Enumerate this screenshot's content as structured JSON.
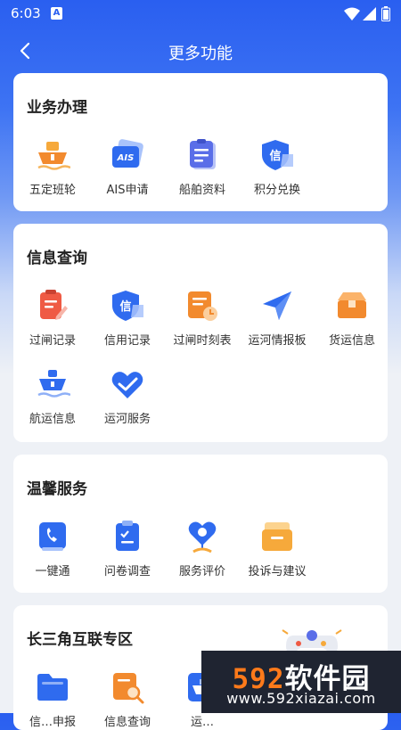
{
  "status_bar": {
    "time": "6:03",
    "notification_badge": "A"
  },
  "nav": {
    "title": "更多功能",
    "back_icon": "chevron-left-icon"
  },
  "sections": [
    {
      "title": "业务办理",
      "items": [
        {
          "label": "五定班轮",
          "icon": "ship-icon"
        },
        {
          "label": "AIS申请",
          "icon": "ais-icon",
          "icon_text": "AIS"
        },
        {
          "label": "船舶资料",
          "icon": "clipboard-icon"
        },
        {
          "label": "积分兑换",
          "icon": "credit-shield-icon",
          "icon_text": "信"
        }
      ]
    },
    {
      "title": "信息查询",
      "items": [
        {
          "label": "过闸记录",
          "icon": "record-edit-icon"
        },
        {
          "label": "信用记录",
          "icon": "credit-shield-icon",
          "icon_text": "信"
        },
        {
          "label": "过闸时刻表",
          "icon": "schedule-clock-icon"
        },
        {
          "label": "运河情报板",
          "icon": "paper-plane-icon"
        },
        {
          "label": "货运信息",
          "icon": "cargo-box-icon"
        },
        {
          "label": "航运信息",
          "icon": "ship-wave-icon"
        },
        {
          "label": "运河服务",
          "icon": "heart-hands-icon"
        }
      ]
    },
    {
      "title": "温馨服务",
      "items": [
        {
          "label": "一键通",
          "icon": "phone-icon"
        },
        {
          "label": "问卷调查",
          "icon": "survey-icon"
        },
        {
          "label": "服务评价",
          "icon": "heart-pin-icon"
        },
        {
          "label": "投诉与建议",
          "icon": "mailbox-icon"
        }
      ]
    },
    {
      "title": "长三角互联专区",
      "items": [
        {
          "label": "信…申报",
          "icon": "folder-icon"
        },
        {
          "label": "信息查询",
          "icon": "search-doc-icon"
        },
        {
          "label": "运…",
          "icon": "ship-doc-icon"
        }
      ]
    }
  ],
  "watermark": {
    "digits": "592",
    "text": "软件园",
    "url": "www.592xiazai.com"
  },
  "colors": {
    "header_blue": "#2a5ff0",
    "icon_blue": "#2f6bef",
    "icon_orange": "#f28a2e",
    "icon_red": "#ef5a44"
  }
}
